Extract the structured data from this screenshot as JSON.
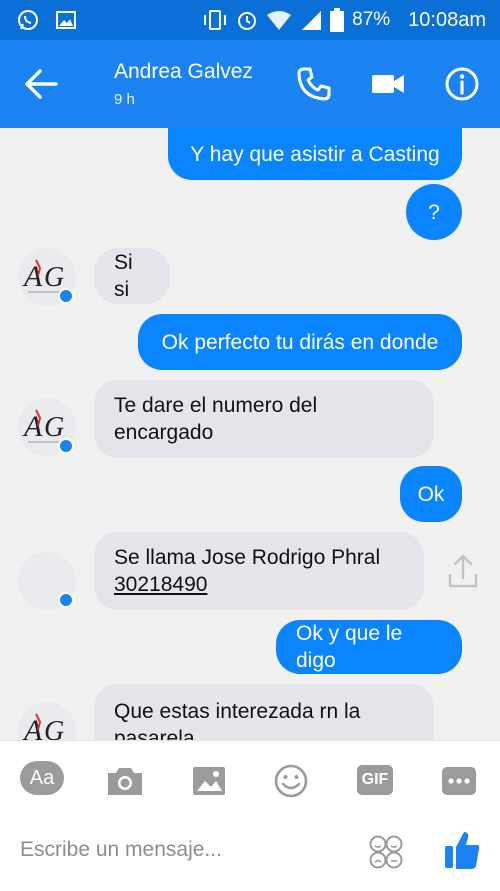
{
  "status": {
    "battery": "87%",
    "time": "10:08am"
  },
  "header": {
    "contact_name": "Andrea Galvez",
    "last_active": "9 h"
  },
  "messages": [
    {
      "text": "Y hay que asistir a Casting"
    },
    {
      "text": "?"
    },
    {
      "text": "Si si"
    },
    {
      "text": "Ok perfecto tu dirás en donde"
    },
    {
      "line1": "Te dare el numero del",
      "line2": "encargado"
    },
    {
      "text": "Ok"
    },
    {
      "line1": "Se llama Jose Rodrigo Phral",
      "phone": "30218490"
    },
    {
      "text": "Ok y que le digo"
    },
    {
      "line1": "Que estas interezada rn la",
      "line2": "pasarela"
    }
  ],
  "composer": {
    "aa_label": "Aa",
    "gif_label": "GIF",
    "placeholder": "Escribe un mensaje..."
  },
  "colors": {
    "header": "#1b84f2",
    "status_bar": "#0b6fd8",
    "outgoing_bubble": "#0a84ff",
    "incoming_bubble": "#e4e6eb"
  }
}
